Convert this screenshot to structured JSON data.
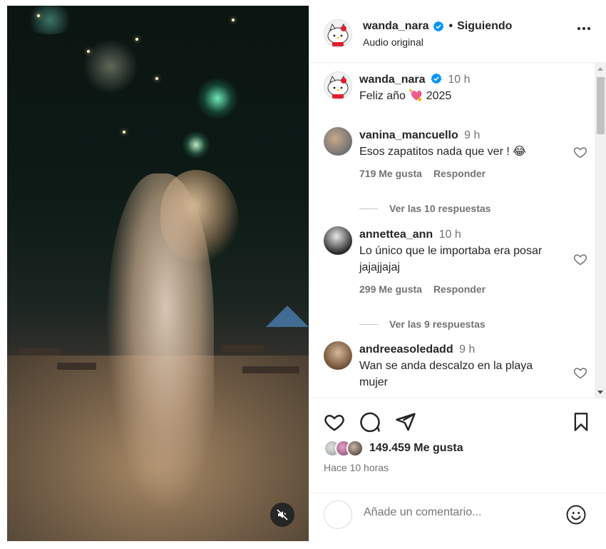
{
  "header": {
    "username": "wanda_nara",
    "separator": "•",
    "follow_status": "Siguiendo",
    "audio": "Audio original"
  },
  "caption": {
    "username": "wanda_nara",
    "time": "10 h",
    "text": "Feliz año 💘 2025"
  },
  "comments": [
    {
      "username": "vanina_mancuello",
      "time": "9 h",
      "text": "Esos zapatitos nada que ver ! 😂",
      "likes": "719 Me gusta",
      "reply": "Responder",
      "view_replies": "Ver las 10 respuestas"
    },
    {
      "username": "annettea_ann",
      "time": "10 h",
      "text": "Lo único que le importaba era posar jajajjajaj",
      "likes": "299 Me gusta",
      "reply": "Responder",
      "view_replies": "Ver las 9 respuestas"
    },
    {
      "username": "andreeasoledadd",
      "time": "9 h",
      "text": "Wan se anda descalzo en la playa mujer"
    }
  ],
  "post": {
    "likes": "149.459 Me gusta",
    "time_ago": "Hace 10 horas"
  },
  "compose": {
    "placeholder": "Añade un comentario..."
  },
  "colors": {
    "verified": "#0095f6",
    "text_primary": "#262626",
    "text_secondary": "#737373"
  }
}
